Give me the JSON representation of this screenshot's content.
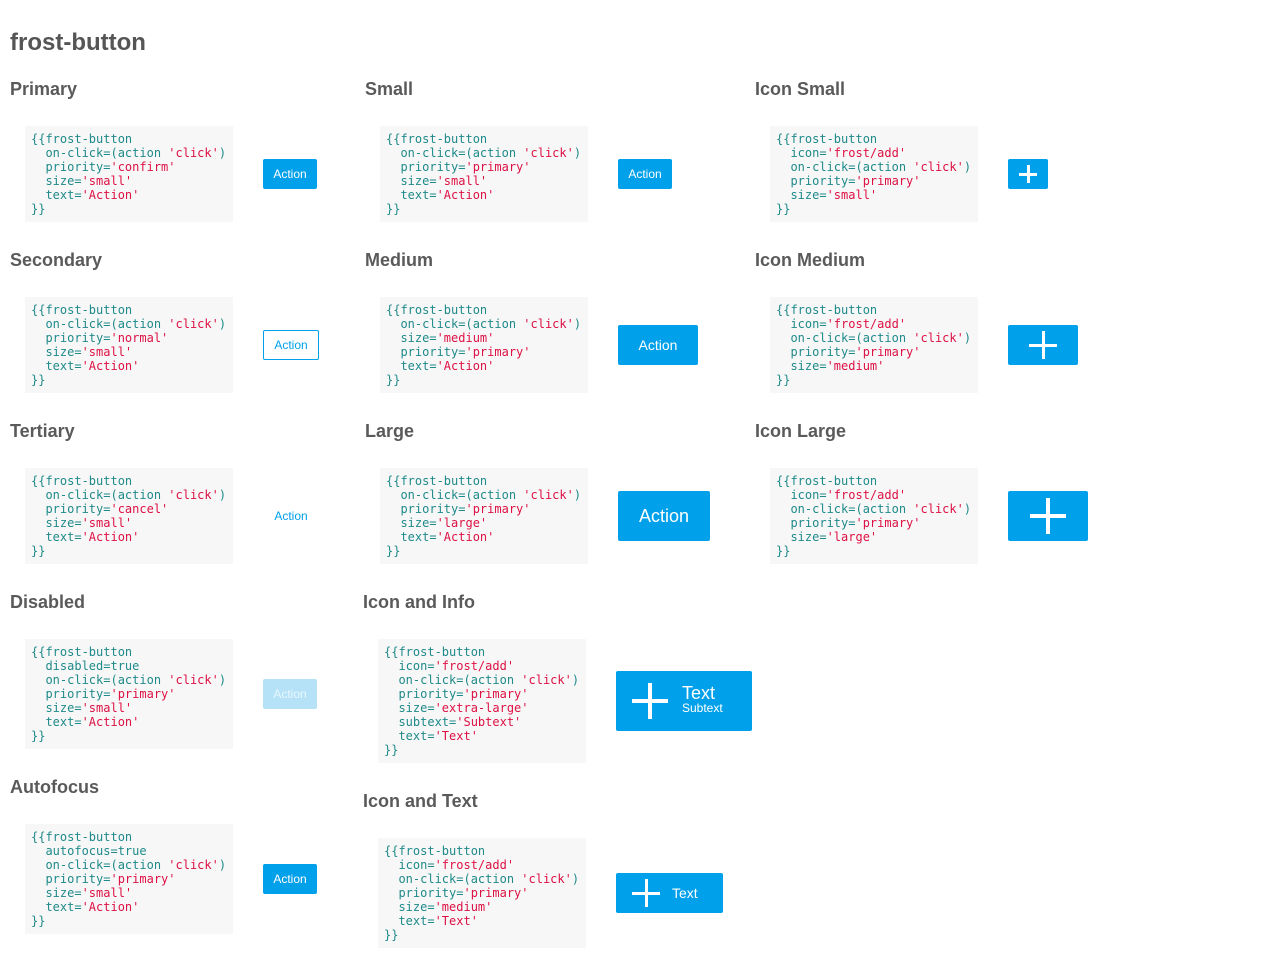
{
  "title": "frost-button",
  "colors": {
    "primary": "#00a0ea",
    "disabled": "#b6e2f8",
    "code_bg": "#f7f7f7",
    "code_ident": "#1f8a8a",
    "code_string": "#dd1144"
  },
  "sections": [
    {
      "id": "primary",
      "title": "Primary",
      "code": [
        "{{frost-button",
        "  on-click=(action 'click')",
        "  priority='confirm'",
        "  size='small'",
        "  text='Action'",
        "}}"
      ],
      "button": {
        "kind": "primary",
        "text": "Action",
        "icon": null
      }
    },
    {
      "id": "secondary",
      "title": "Secondary",
      "code": [
        "{{frost-button",
        "  on-click=(action 'click')",
        "  priority='normal'",
        "  size='small'",
        "  text='Action'",
        "}}"
      ],
      "button": {
        "kind": "secondary",
        "text": "Action",
        "icon": null
      }
    },
    {
      "id": "tertiary",
      "title": "Tertiary",
      "code": [
        "{{frost-button",
        "  on-click=(action 'click')",
        "  priority='cancel'",
        "  size='small'",
        "  text='Action'",
        "}}"
      ],
      "button": {
        "kind": "tertiary",
        "text": "Action",
        "icon": null
      }
    },
    {
      "id": "disabled",
      "title": "Disabled",
      "code": [
        "{{frost-button",
        "  disabled=true",
        "  on-click=(action 'click')",
        "  priority='primary'",
        "  size='small'",
        "  text='Action'",
        "}}"
      ],
      "button": {
        "kind": "disabled",
        "text": "Action",
        "icon": null
      }
    },
    {
      "id": "autofocus",
      "title": "Autofocus",
      "code": [
        "{{frost-button",
        "  autofocus=true",
        "  on-click=(action 'click')",
        "  priority='primary'",
        "  size='small'",
        "  text='Action'",
        "}}"
      ],
      "button": {
        "kind": "primary",
        "text": "Action",
        "icon": null
      }
    },
    {
      "id": "small",
      "title": "Small",
      "code": [
        "{{frost-button",
        "  on-click=(action 'click')",
        "  priority='primary'",
        "  size='small'",
        "  text='Action'",
        "}}"
      ],
      "button": {
        "kind": "primary",
        "text": "Action",
        "icon": null
      }
    },
    {
      "id": "medium",
      "title": "Medium",
      "code": [
        "{{frost-button",
        "  on-click=(action 'click')",
        "  size='medium'",
        "  priority='primary'",
        "  text='Action'",
        "}}"
      ],
      "button": {
        "kind": "primary",
        "text": "Action",
        "icon": null
      }
    },
    {
      "id": "large",
      "title": "Large",
      "code": [
        "{{frost-button",
        "  on-click=(action 'click')",
        "  priority='primary'",
        "  size='large'",
        "  text='Action'",
        "}}"
      ],
      "button": {
        "kind": "primary",
        "text": "Action",
        "icon": null
      }
    },
    {
      "id": "icon-info",
      "title": "Icon and Info",
      "code": [
        "{{frost-button",
        "  icon='frost/add'",
        "  on-click=(action 'click')",
        "  priority='primary'",
        "  size='extra-large'",
        "  subtext='Subtext'",
        "  text='Text'",
        "}}"
      ],
      "button": {
        "kind": "primary",
        "text": "Text",
        "subtext": "Subtext",
        "icon": "add"
      }
    },
    {
      "id": "icon-text",
      "title": "Icon and Text",
      "code": [
        "{{frost-button",
        "  icon='frost/add'",
        "  on-click=(action 'click')",
        "  priority='primary'",
        "  size='medium'",
        "  text='Text'",
        "}}"
      ],
      "button": {
        "kind": "primary",
        "text": "Text",
        "icon": "add"
      }
    },
    {
      "id": "icon-small",
      "title": "Icon Small",
      "code": [
        "{{frost-button",
        "  icon='frost/add'",
        "  on-click=(action 'click')",
        "  priority='primary'",
        "  size='small'",
        "}}"
      ],
      "button": {
        "kind": "primary",
        "icon": "add"
      }
    },
    {
      "id": "icon-medium",
      "title": "Icon Medium",
      "code": [
        "{{frost-button",
        "  icon='frost/add'",
        "  on-click=(action 'click')",
        "  priority='primary'",
        "  size='medium'",
        "}}"
      ],
      "button": {
        "kind": "primary",
        "icon": "add"
      }
    },
    {
      "id": "icon-large",
      "title": "Icon Large",
      "code": [
        "{{frost-button",
        "  icon='frost/add'",
        "  on-click=(action 'click')",
        "  priority='primary'",
        "  size='large'",
        "}}"
      ],
      "button": {
        "kind": "primary",
        "icon": "add"
      }
    }
  ]
}
